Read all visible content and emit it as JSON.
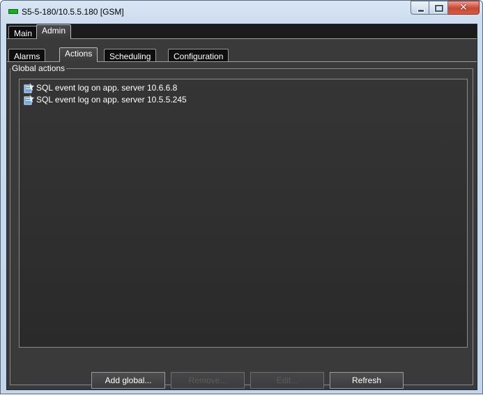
{
  "window": {
    "title": "S5-5-180/10.5.5.180 [GSM]",
    "controls": {
      "minimize": "minimize-icon",
      "maximize": "maximize-icon",
      "close": "✕"
    }
  },
  "main_tabs": [
    {
      "label": "Main",
      "active": false
    },
    {
      "label": "Admin",
      "active": true
    }
  ],
  "admin_tabs": [
    {
      "label": "Alarms",
      "active": false
    },
    {
      "label": "Actions",
      "active": true
    },
    {
      "label": "Scheduling",
      "active": false
    },
    {
      "label": "Configuration",
      "active": false
    }
  ],
  "global_actions": {
    "title": "Global actions",
    "items": [
      {
        "label": "SQL event log on app. server 10.6.6.8",
        "icon": "sql-action-icon"
      },
      {
        "label": "SQL event log on app. server 10.5.5.245",
        "icon": "sql-action-icon"
      }
    ]
  },
  "buttons": {
    "add_global": "Add global...",
    "remove": "Remove...",
    "edit": "Edit...",
    "refresh": "Refresh"
  },
  "colors": {
    "panel_bg": "#3a3a3a",
    "list_bg": "#2f2f2f",
    "status_green": "#1faa28"
  }
}
